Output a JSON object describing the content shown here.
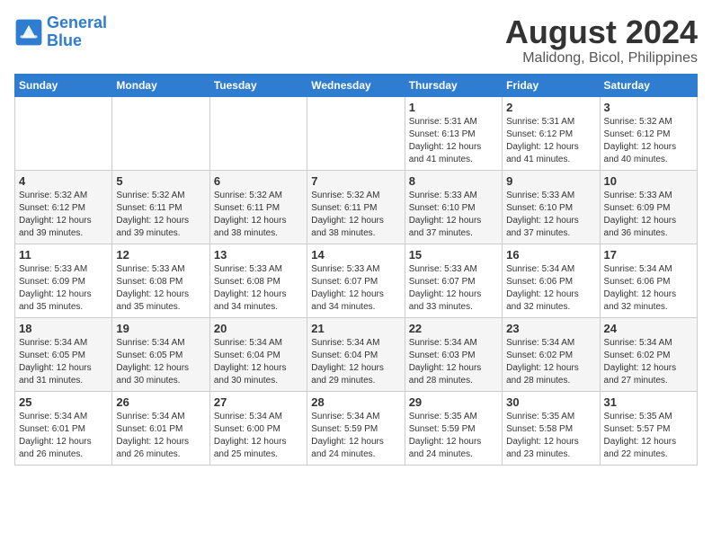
{
  "logo": {
    "line1": "General",
    "line2": "Blue"
  },
  "title": "August 2024",
  "subtitle": "Malidong, Bicol, Philippines",
  "days_of_week": [
    "Sunday",
    "Monday",
    "Tuesday",
    "Wednesday",
    "Thursday",
    "Friday",
    "Saturday"
  ],
  "weeks": [
    [
      {
        "day": "",
        "info": ""
      },
      {
        "day": "",
        "info": ""
      },
      {
        "day": "",
        "info": ""
      },
      {
        "day": "",
        "info": ""
      },
      {
        "day": "1",
        "info": "Sunrise: 5:31 AM\nSunset: 6:13 PM\nDaylight: 12 hours\nand 41 minutes."
      },
      {
        "day": "2",
        "info": "Sunrise: 5:31 AM\nSunset: 6:12 PM\nDaylight: 12 hours\nand 41 minutes."
      },
      {
        "day": "3",
        "info": "Sunrise: 5:32 AM\nSunset: 6:12 PM\nDaylight: 12 hours\nand 40 minutes."
      }
    ],
    [
      {
        "day": "4",
        "info": "Sunrise: 5:32 AM\nSunset: 6:12 PM\nDaylight: 12 hours\nand 39 minutes."
      },
      {
        "day": "5",
        "info": "Sunrise: 5:32 AM\nSunset: 6:11 PM\nDaylight: 12 hours\nand 39 minutes."
      },
      {
        "day": "6",
        "info": "Sunrise: 5:32 AM\nSunset: 6:11 PM\nDaylight: 12 hours\nand 38 minutes."
      },
      {
        "day": "7",
        "info": "Sunrise: 5:32 AM\nSunset: 6:11 PM\nDaylight: 12 hours\nand 38 minutes."
      },
      {
        "day": "8",
        "info": "Sunrise: 5:33 AM\nSunset: 6:10 PM\nDaylight: 12 hours\nand 37 minutes."
      },
      {
        "day": "9",
        "info": "Sunrise: 5:33 AM\nSunset: 6:10 PM\nDaylight: 12 hours\nand 37 minutes."
      },
      {
        "day": "10",
        "info": "Sunrise: 5:33 AM\nSunset: 6:09 PM\nDaylight: 12 hours\nand 36 minutes."
      }
    ],
    [
      {
        "day": "11",
        "info": "Sunrise: 5:33 AM\nSunset: 6:09 PM\nDaylight: 12 hours\nand 35 minutes."
      },
      {
        "day": "12",
        "info": "Sunrise: 5:33 AM\nSunset: 6:08 PM\nDaylight: 12 hours\nand 35 minutes."
      },
      {
        "day": "13",
        "info": "Sunrise: 5:33 AM\nSunset: 6:08 PM\nDaylight: 12 hours\nand 34 minutes."
      },
      {
        "day": "14",
        "info": "Sunrise: 5:33 AM\nSunset: 6:07 PM\nDaylight: 12 hours\nand 34 minutes."
      },
      {
        "day": "15",
        "info": "Sunrise: 5:33 AM\nSunset: 6:07 PM\nDaylight: 12 hours\nand 33 minutes."
      },
      {
        "day": "16",
        "info": "Sunrise: 5:34 AM\nSunset: 6:06 PM\nDaylight: 12 hours\nand 32 minutes."
      },
      {
        "day": "17",
        "info": "Sunrise: 5:34 AM\nSunset: 6:06 PM\nDaylight: 12 hours\nand 32 minutes."
      }
    ],
    [
      {
        "day": "18",
        "info": "Sunrise: 5:34 AM\nSunset: 6:05 PM\nDaylight: 12 hours\nand 31 minutes."
      },
      {
        "day": "19",
        "info": "Sunrise: 5:34 AM\nSunset: 6:05 PM\nDaylight: 12 hours\nand 30 minutes."
      },
      {
        "day": "20",
        "info": "Sunrise: 5:34 AM\nSunset: 6:04 PM\nDaylight: 12 hours\nand 30 minutes."
      },
      {
        "day": "21",
        "info": "Sunrise: 5:34 AM\nSunset: 6:04 PM\nDaylight: 12 hours\nand 29 minutes."
      },
      {
        "day": "22",
        "info": "Sunrise: 5:34 AM\nSunset: 6:03 PM\nDaylight: 12 hours\nand 28 minutes."
      },
      {
        "day": "23",
        "info": "Sunrise: 5:34 AM\nSunset: 6:02 PM\nDaylight: 12 hours\nand 28 minutes."
      },
      {
        "day": "24",
        "info": "Sunrise: 5:34 AM\nSunset: 6:02 PM\nDaylight: 12 hours\nand 27 minutes."
      }
    ],
    [
      {
        "day": "25",
        "info": "Sunrise: 5:34 AM\nSunset: 6:01 PM\nDaylight: 12 hours\nand 26 minutes."
      },
      {
        "day": "26",
        "info": "Sunrise: 5:34 AM\nSunset: 6:01 PM\nDaylight: 12 hours\nand 26 minutes."
      },
      {
        "day": "27",
        "info": "Sunrise: 5:34 AM\nSunset: 6:00 PM\nDaylight: 12 hours\nand 25 minutes."
      },
      {
        "day": "28",
        "info": "Sunrise: 5:34 AM\nSunset: 5:59 PM\nDaylight: 12 hours\nand 24 minutes."
      },
      {
        "day": "29",
        "info": "Sunrise: 5:35 AM\nSunset: 5:59 PM\nDaylight: 12 hours\nand 24 minutes."
      },
      {
        "day": "30",
        "info": "Sunrise: 5:35 AM\nSunset: 5:58 PM\nDaylight: 12 hours\nand 23 minutes."
      },
      {
        "day": "31",
        "info": "Sunrise: 5:35 AM\nSunset: 5:57 PM\nDaylight: 12 hours\nand 22 minutes."
      }
    ]
  ]
}
